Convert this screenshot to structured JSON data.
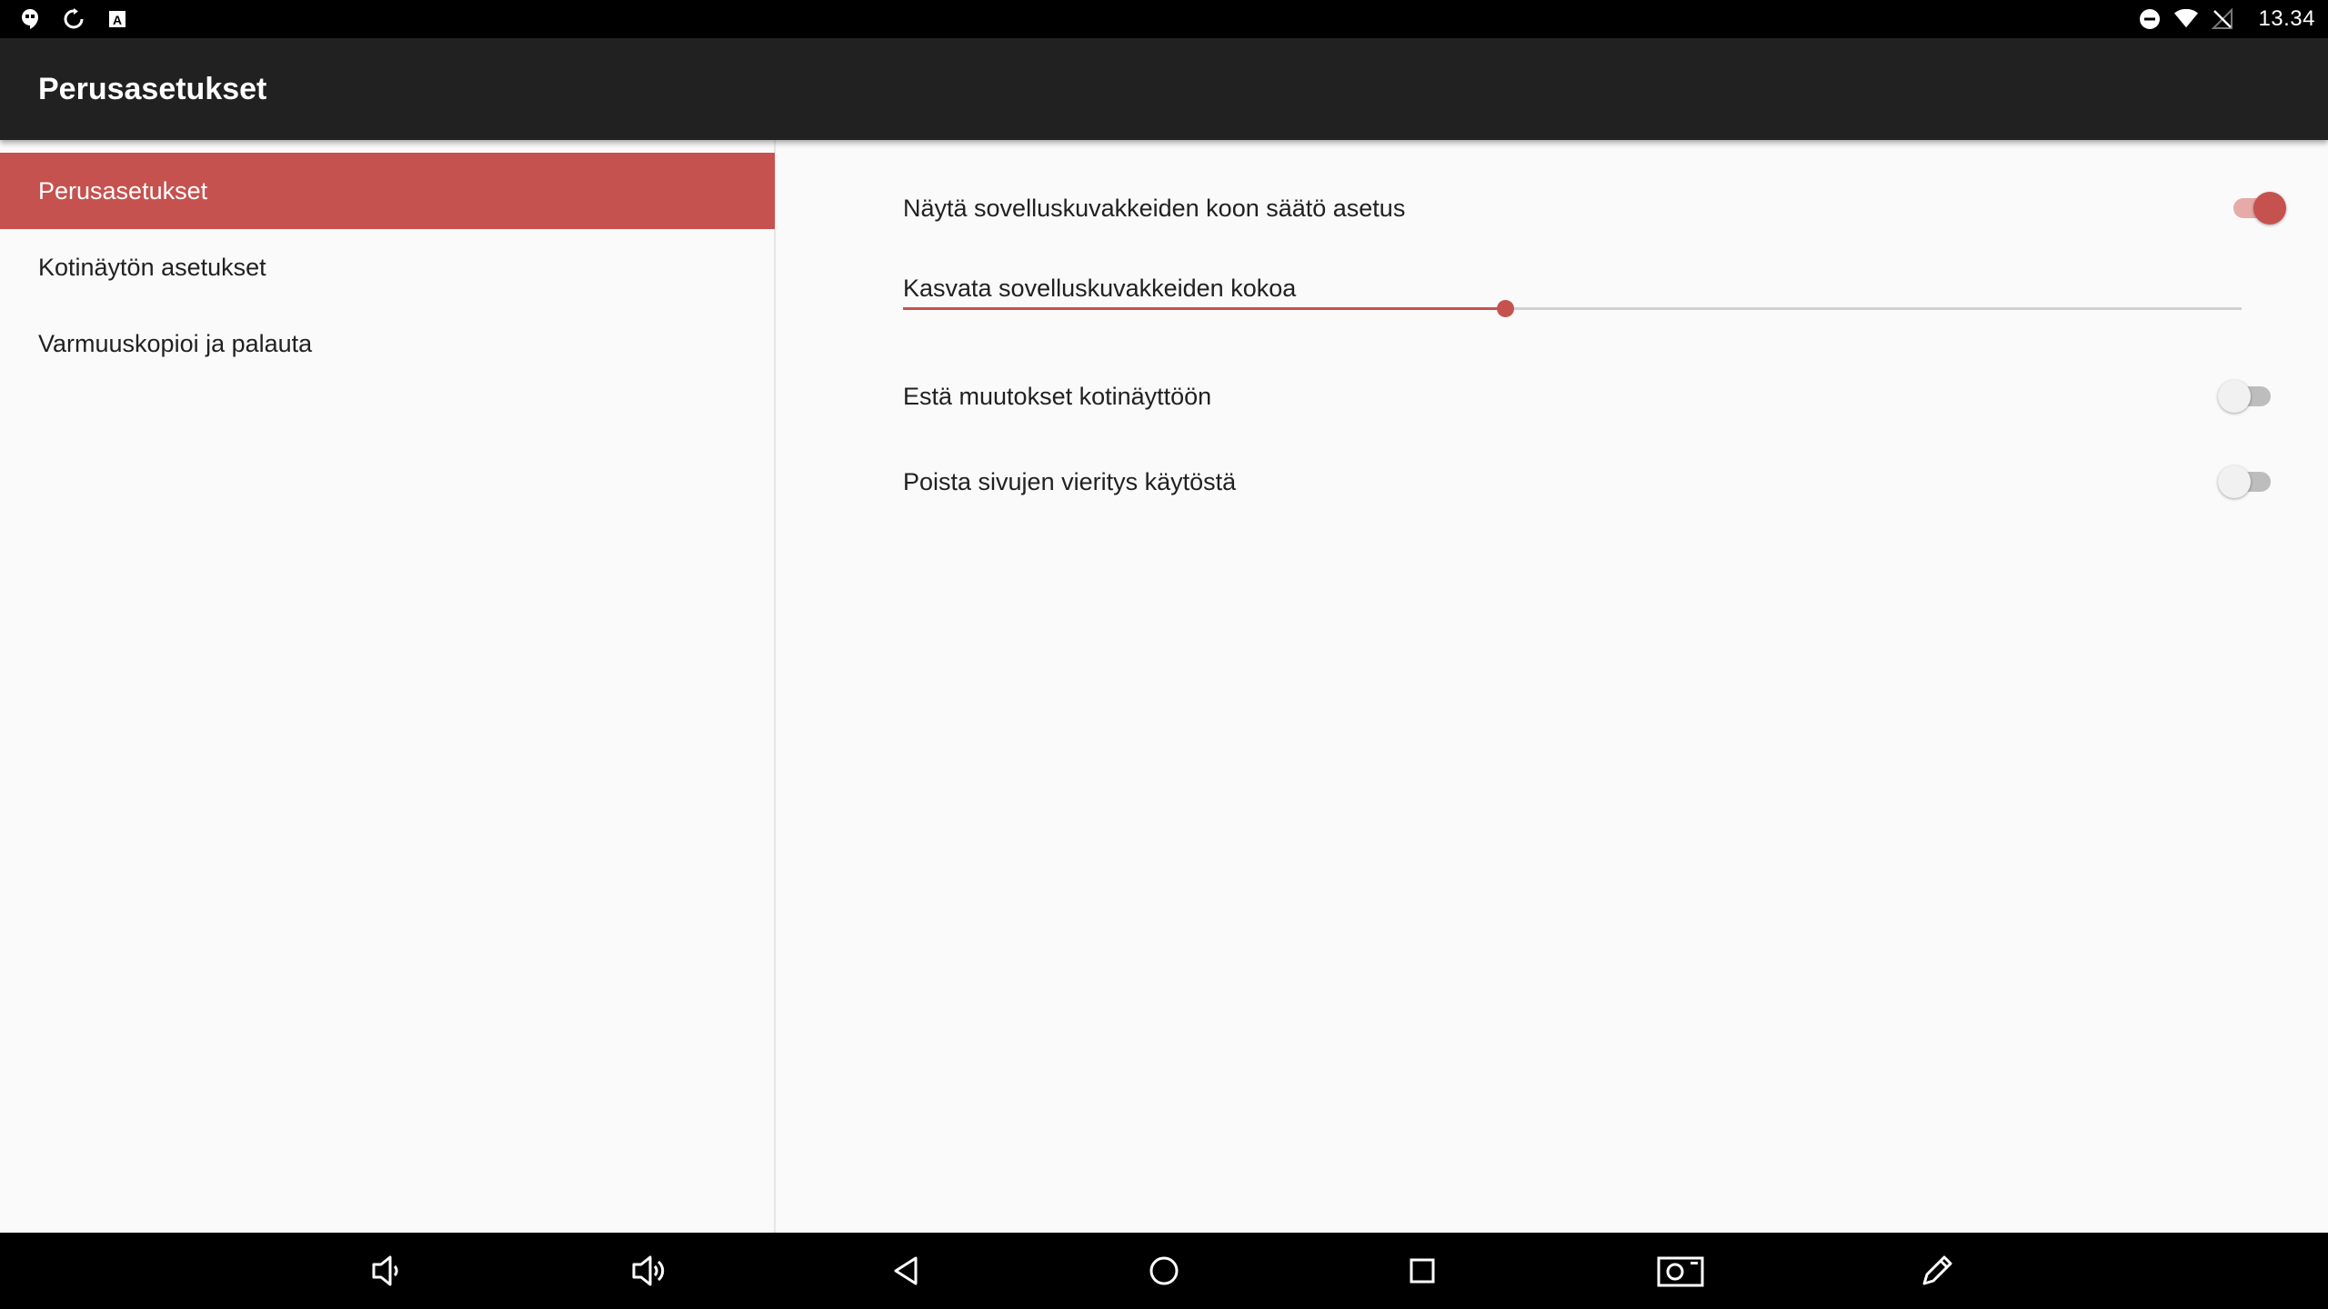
{
  "status_bar": {
    "time": "13.34",
    "left_icons": [
      "hangouts-icon",
      "sync-icon",
      "text-a-icon"
    ],
    "right_icons": [
      "do-not-disturb-icon",
      "wifi-icon",
      "no-signal-icon"
    ]
  },
  "app_bar": {
    "title": "Perusasetukset"
  },
  "sidebar": {
    "items": [
      {
        "label": "Perusasetukset",
        "active": true
      },
      {
        "label": "Kotinäytön asetukset",
        "active": false
      },
      {
        "label": "Varmuuskopioi ja palauta",
        "active": false
      }
    ]
  },
  "preferences": {
    "show_icon_size": {
      "label": "Näytä sovelluskuvakkeiden koon säätö asetus",
      "enabled": true
    },
    "icon_size": {
      "label": "Kasvata sovelluskuvakkeiden kokoa",
      "value": 0.45
    },
    "lock_home": {
      "label": "Estä muutokset kotinäyttöön",
      "enabled": false
    },
    "disable_scroll": {
      "label": "Poista sivujen vieritys käytöstä",
      "enabled": false
    }
  },
  "navigation_bar": {
    "buttons": [
      "volume-down-icon",
      "volume-up-icon",
      "back-icon",
      "home-icon",
      "recents-icon",
      "screenshot-icon",
      "edit-icon"
    ]
  },
  "colors": {
    "accent": "#c5524f",
    "accent_light": "#e6aaa8",
    "app_bar": "#212121",
    "background": "#fafafa"
  }
}
